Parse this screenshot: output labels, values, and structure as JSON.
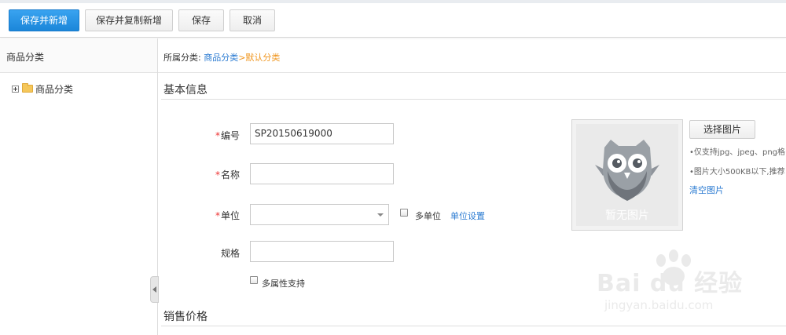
{
  "toolbar": {
    "save_new": "保存并新增",
    "save_copy_new": "保存并复制新增",
    "save": "保存",
    "cancel": "取消"
  },
  "sidebar": {
    "title": "商品分类",
    "tree": [
      {
        "label": "商品分类",
        "expand_icon": "plus-square-icon",
        "icon": "folder-icon"
      }
    ]
  },
  "breadcrumb": {
    "prefix": "所属分类: ",
    "link": "商品分类",
    "separator": ">",
    "current": "默认分类"
  },
  "sections": {
    "basic_info": "基本信息",
    "sales_price": "销售价格"
  },
  "form": {
    "code": {
      "required_mark": "*",
      "label": "编号",
      "value": "SP20150619000"
    },
    "name": {
      "required_mark": "*",
      "label": "名称",
      "value": ""
    },
    "unit": {
      "required_mark": "*",
      "label": "单位",
      "value": ""
    },
    "multi_unit": {
      "label": "多单位",
      "checked": false
    },
    "unit_settings": "单位设置",
    "spec": {
      "label": "规格",
      "value": ""
    },
    "multi_attr": {
      "label": "多属性支持",
      "checked": false
    }
  },
  "image": {
    "placeholder_text": "暂无图片",
    "placeholder_icon": "owl-icon",
    "select_button": "选择图片",
    "hint_format": "•仅支持jpg、jpeg、png格",
    "hint_size": "•图片大小500KB以下,推荐",
    "clear_link": "清空图片"
  },
  "watermark": {
    "main": "Bai du 经验",
    "sub": "jingyan.baidu.com"
  },
  "colors": {
    "primary": "#1b86d9",
    "link": "#2b7bd2",
    "breadcrumb_current": "#f0961f",
    "required": "#e33333"
  }
}
